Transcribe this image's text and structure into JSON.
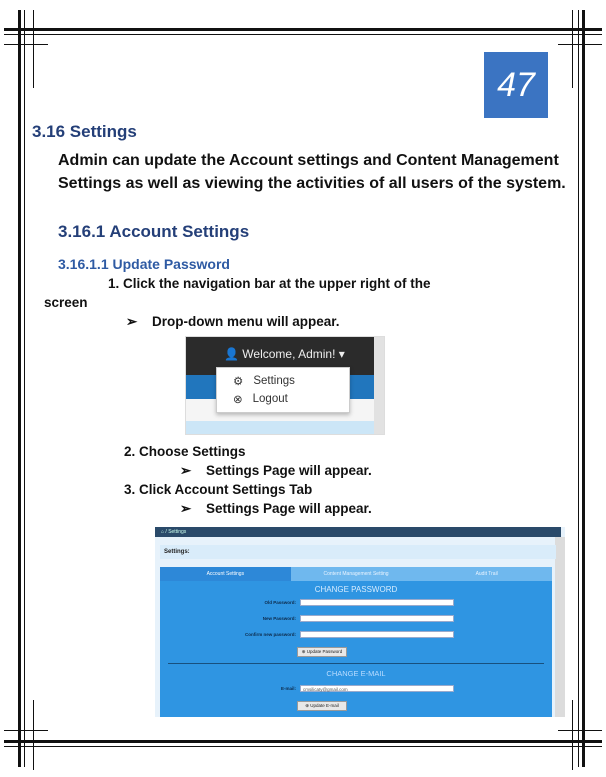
{
  "page_number": "47",
  "section": {
    "title": "3.16 Settings",
    "description": "Admin can update the Account settings and Content Management Settings as well as viewing the activities of all users of the system."
  },
  "subsection": {
    "title": "3.16.1 Account Settings"
  },
  "subsubsection": {
    "title": "3.16.1.1 Update Password"
  },
  "steps": {
    "s1_line1": "1. Click the navigation bar at the upper right of the",
    "s1_line2": "screen",
    "s1_bullet": "Drop-down menu will appear.",
    "s2": "2. Choose Settings",
    "s2_bullet": "Settings Page will appear.",
    "s3": "3. Click Account Settings Tab",
    "s3_bullet": "Settings Page will appear."
  },
  "arrow_glyph": "➢",
  "screenshot_dropdown": {
    "welcome": "Welcome, Admin! ▾",
    "items": [
      "Settings",
      "Logout"
    ]
  },
  "screenshot_settings": {
    "breadcrumb": "⌂ / Settings",
    "panel_title": "Settings:",
    "tabs": [
      "Account Settings",
      "Content Management Setting",
      "Audit Trail"
    ],
    "change_password_heading": "CHANGE PASSWORD",
    "fields": [
      "Old Password:",
      "New Password:",
      "Confirm new password:"
    ],
    "update_password_button": "⊕ Update Password",
    "change_email_heading": "CHANGE E-MAIL",
    "email_label": "E-mail:",
    "email_value": "cmsilicaty@gmail.com",
    "update_email_button": "⊕ Update E-mail"
  }
}
